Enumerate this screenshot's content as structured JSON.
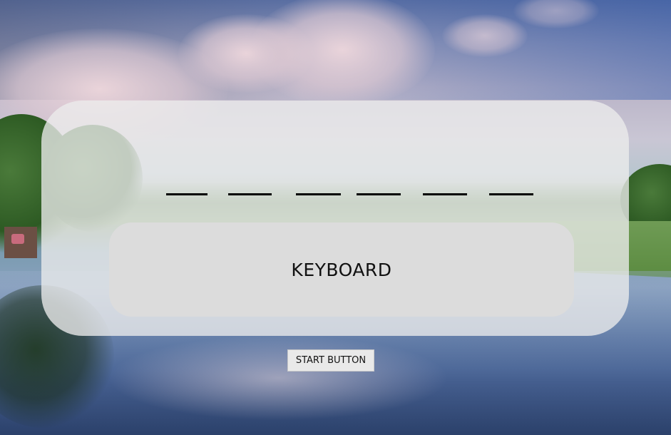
{
  "game": {
    "word_slot_count": 6,
    "keyboard_label": "KEYBOARD",
    "start_button_label": "START BUTTON"
  },
  "colors": {
    "panel": "#ececec",
    "keyboard": "#dcdcdc",
    "slot_line": "#000000",
    "button": "#e9e9e9"
  }
}
